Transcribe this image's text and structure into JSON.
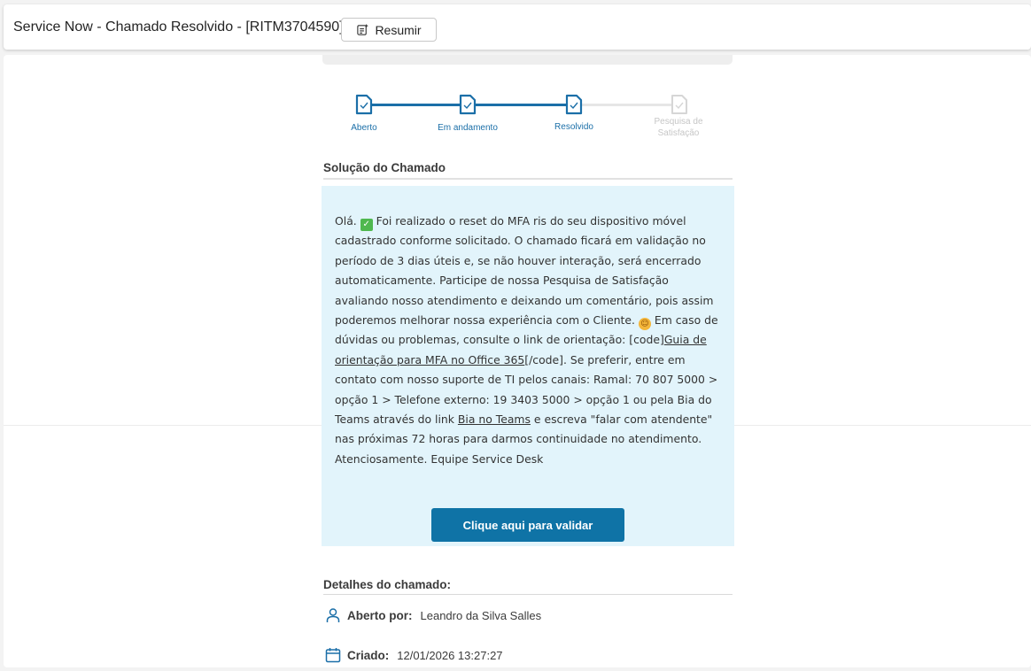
{
  "header": {
    "title": "Service Now - Chamado Resolvido - [RITM3704590]",
    "summary_label": "Resumir"
  },
  "stepper": {
    "steps": [
      {
        "label": "Aberto",
        "state": "done"
      },
      {
        "label": "Em andamento",
        "state": "done"
      },
      {
        "label": "Resolvido",
        "state": "done"
      },
      {
        "label": "Pesquisa de Satisfação",
        "state": "pending"
      }
    ],
    "active_color": "#1b6fa8",
    "inactive_color": "#c6c6c6"
  },
  "solution": {
    "title": "Solução do Chamado",
    "greeting": "Olá.",
    "text_1": "Foi realizado o reset do MFA ris do seu dispositivo móvel cadastrado conforme solicitado. O chamado ficará em validação no período de 3 dias úteis e, se não houver interação, será encerrado automaticamente. Participe de nossa Pesquisa de Satisfação avaliando nosso atendimento e deixando um comentário, pois assim poderemos melhorar nossa experiência com o Cliente.",
    "text_2": "Em caso de dúvidas ou problemas, consulte o link de orientação: [code]",
    "link_guide": "Guia de orientação para MFA no Office 365",
    "text_3": "[/code]. Se preferir, entre em contato com nosso suporte de TI pelos canais: Ramal: 70 807 5000 > opção 1 > Telefone externo: 19 3403 5000 > opção 1 ou pela Bia do Teams através do link",
    "link_bia": "Bia no Teams",
    "text_4": "e escreva \"falar com atendente\" nas próximas 72 horas para darmos continuidade no atendimento. Atenciosamente. Equipe Service Desk",
    "validate_button": "Clique aqui para validar",
    "box_color": "#e2f4fb",
    "button_color": "#0f73a6"
  },
  "details": {
    "title": "Detalhes do chamado:",
    "opened_by_label": "Aberto por:",
    "opened_by_value": "Leandro da Silva Salles",
    "created_label": "Criado:",
    "created_value": "12/01/2026 13:27:27",
    "icons": [
      "person-icon",
      "calendar-icon"
    ]
  }
}
